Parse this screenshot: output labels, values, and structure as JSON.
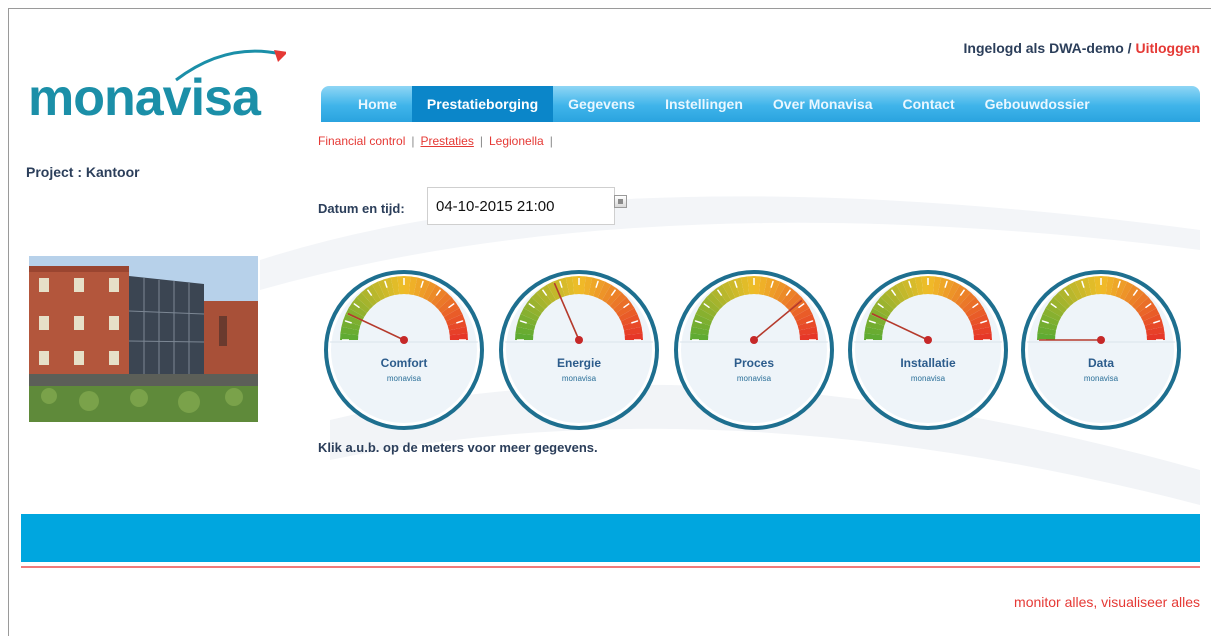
{
  "header": {
    "logo_text": "monavisa",
    "login_prefix": "Ingelogd als DWA-demo /",
    "logout_label": "Uitloggen"
  },
  "nav": {
    "items": [
      {
        "label": "Home"
      },
      {
        "label": "Prestatieborging",
        "active": true
      },
      {
        "label": "Gegevens"
      },
      {
        "label": "Instellingen"
      },
      {
        "label": "Over Monavisa"
      },
      {
        "label": "Contact"
      },
      {
        "label": "Gebouwdossier"
      }
    ]
  },
  "subnav": {
    "items": [
      "Financial control",
      "Prestaties",
      "Legionella"
    ],
    "active": "Prestaties"
  },
  "project": {
    "label": "Project : Kantoor"
  },
  "datetime": {
    "label": "Datum en tijd:",
    "value": "04-10-2015 21:00"
  },
  "gauges": [
    {
      "label": "Comfort",
      "brand": "monavisa",
      "level": 0.14
    },
    {
      "label": "Energie",
      "brand": "monavisa",
      "level": 0.37
    },
    {
      "label": "Proces",
      "brand": "monavisa",
      "level": 0.78
    },
    {
      "label": "Installatie",
      "brand": "monavisa",
      "level": 0.14
    },
    {
      "label": "Data",
      "brand": "monavisa",
      "level": 0.0
    }
  ],
  "hint": "Klik a.u.b. op de meters voor meer gegevens.",
  "footer": {
    "tagline": "monitor alles, visualiseer alles"
  },
  "colors": {
    "brand": "#1b8fa8",
    "nav": "#3fb4ea",
    "accent_red": "#e53935",
    "footer_bar": "#00a6df"
  }
}
